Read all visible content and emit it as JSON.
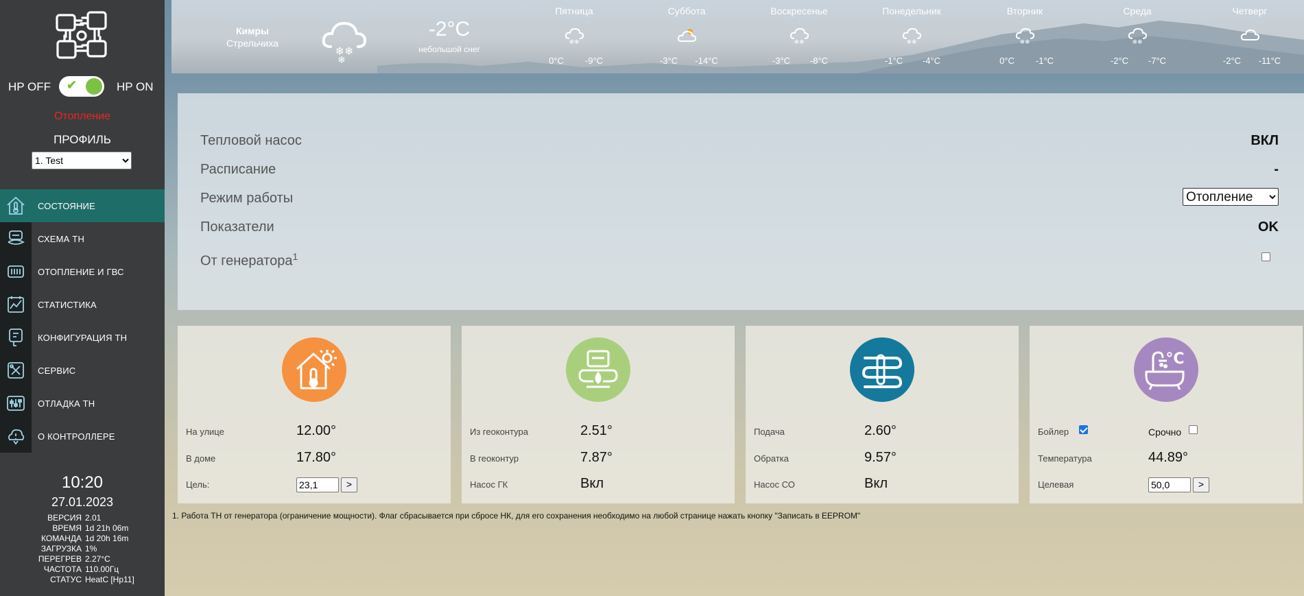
{
  "sidebar": {
    "hp_off": "HP OFF",
    "hp_on": "HP ON",
    "switch_on": true,
    "mode": "Отопление",
    "profile_label": "ПРОФИЛЬ",
    "profile_value": "1. Test",
    "nav": [
      {
        "label": "СОСТОЯНИЕ",
        "icon": "home-thermometer-icon",
        "active": true
      },
      {
        "label": "СХЕМА ТН",
        "icon": "heat-pump-scheme-icon",
        "active": false
      },
      {
        "label": "ОТОПЛЕНИЕ И ГВС",
        "icon": "heating-dhw-icon",
        "active": false
      },
      {
        "label": "СТАТИСТИКА",
        "icon": "statistics-chart-icon",
        "active": false
      },
      {
        "label": "КОНФИГУРАЦИЯ ТН",
        "icon": "configuration-icon",
        "active": false
      },
      {
        "label": "СЕРВИС",
        "icon": "service-tools-icon",
        "active": false
      },
      {
        "label": "ОТЛАДКА ТН",
        "icon": "debug-sliders-icon",
        "active": false
      },
      {
        "label": "О КОНТРОЛЛЕРЕ",
        "icon": "controller-info-icon",
        "active": false
      }
    ],
    "time": "10:20",
    "date": "27.01.2023",
    "info": [
      {
        "key": "ВЕРСИЯ",
        "value": "2.01"
      },
      {
        "key": "ВРЕМЯ",
        "value": "1d 21h 06m"
      },
      {
        "key": "КОМАНДА",
        "value": "1d 20h 16m"
      },
      {
        "key": "ЗАГРУЗКА",
        "value": "1%"
      },
      {
        "key": "ПЕРЕГРЕВ",
        "value": "2.27°C"
      },
      {
        "key": "ЧАСТОТА",
        "value": "110.00Гц"
      },
      {
        "key": "СТАТУС",
        "value": "HeatC [Hp11]"
      }
    ]
  },
  "weather": {
    "city": "Кимры",
    "place": "Стрельчиха",
    "icon": "snow-cloud-icon",
    "temp": "-2°C",
    "description": "небольшой снег",
    "days": [
      {
        "name": "Пятница",
        "icon": "snow-cloud-icon",
        "min": "0°C",
        "max": "-9°C"
      },
      {
        "name": "Суббота",
        "icon": "cloud-sun-icon",
        "min": "-3°C",
        "max": "-14°C"
      },
      {
        "name": "Воскресенье",
        "icon": "snow-cloud-icon",
        "min": "-3°C",
        "max": "-8°C"
      },
      {
        "name": "Понедельник",
        "icon": "snow-cloud-icon",
        "min": "-1°C",
        "max": "-4°C"
      },
      {
        "name": "Вторник",
        "icon": "snow-cloud-icon",
        "min": "0°C",
        "max": "-1°C"
      },
      {
        "name": "Среда",
        "icon": "snow-cloud-icon",
        "min": "-2°C",
        "max": "-7°C"
      },
      {
        "name": "Четверг",
        "icon": "cloud-icon",
        "min": "-2°C",
        "max": "-11°C"
      }
    ]
  },
  "status": {
    "heat_pump_label": "Тепловой насос",
    "heat_pump_value": "ВКЛ",
    "schedule_label": "Расписание",
    "schedule_value": "-",
    "mode_label": "Режим работы",
    "mode_value": "Отопление",
    "indicators_label": "Показатели",
    "indicators_value": "OK",
    "generator_label": "От генератора",
    "generator_sup": "1",
    "generator_checked": false
  },
  "cards": {
    "outdoor": {
      "icon": "house-thermometer-sun-icon",
      "color": "#f5913f",
      "row1_label": "На улице",
      "row1_value": "12.00°",
      "row2_label": "В доме",
      "row2_value": "17.80°",
      "row3_label": "Цель:",
      "row3_input": "23,1",
      "row3_button": ">"
    },
    "ground": {
      "icon": "geo-circuit-icon",
      "color": "#a9cf7d",
      "row1_label": "Из геоконтура",
      "row1_value": "2.51°",
      "row2_label": "В геоконтур",
      "row2_value": "7.87°",
      "row3_label": "Насос ГК",
      "row3_value": "Вкл"
    },
    "heating": {
      "icon": "floor-heating-icon",
      "color": "#14799c",
      "row1_label": "Подача",
      "row1_value": "2.60°",
      "row2_label": "Обратка",
      "row2_value": "9.57°",
      "row3_label": "Насос СО",
      "row3_value": "Вкл"
    },
    "boiler": {
      "icon": "bathtub-temperature-icon",
      "color": "#a688c0",
      "icon_text": "°C",
      "boiler_label": "Бойлер",
      "boiler_checked": true,
      "urgent_label": "Срочно",
      "urgent_checked": false,
      "row2_label": "Температура",
      "row2_value": "44.89°",
      "row3_label": "Целевая",
      "row3_input": "50,0",
      "row3_button": ">"
    }
  },
  "footnote": "1. Работа ТН от генератора (ограничение мощности). Флаг сбрасывается при сбросе НК, для его сохранения необходимо на любой странице нажать кнопку \"Записать в EEPROM\""
}
